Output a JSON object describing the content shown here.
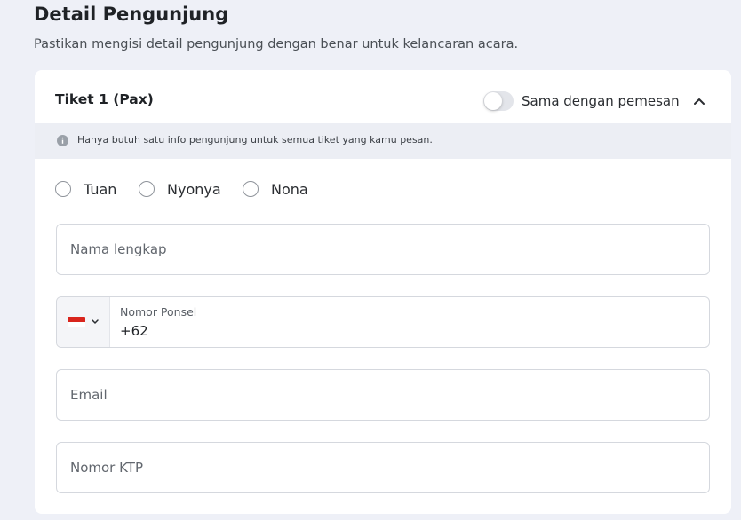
{
  "page": {
    "title": "Detail Pengunjung",
    "subtitle": "Pastikan mengisi detail pengunjung dengan benar untuk kelancaran acara."
  },
  "ticket": {
    "title": "Tiket 1 (Pax)",
    "same_as_booker_label": "Sama dengan pemesan",
    "same_as_booker_on": false,
    "info": "Hanya butuh satu info pengunjung untuk semua tiket yang kamu pesan."
  },
  "title_options": [
    "Tuan",
    "Nyonya",
    "Nona"
  ],
  "form": {
    "full_name_placeholder": "Nama lengkap",
    "phone_label": "Nomor Ponsel",
    "phone_prefix": "+62",
    "email_placeholder": "Email",
    "ktp_placeholder": "Nomor KTP"
  },
  "icons": {
    "collapse": "chevron-up-icon",
    "info": "info-icon",
    "country_dropdown": "chevron-down-icon",
    "flag": "indonesia-flag-icon"
  },
  "colors": {
    "background": "#eef0f7",
    "card": "#ffffff",
    "info_bar": "#eceef4",
    "flag_red": "#d9251d"
  }
}
